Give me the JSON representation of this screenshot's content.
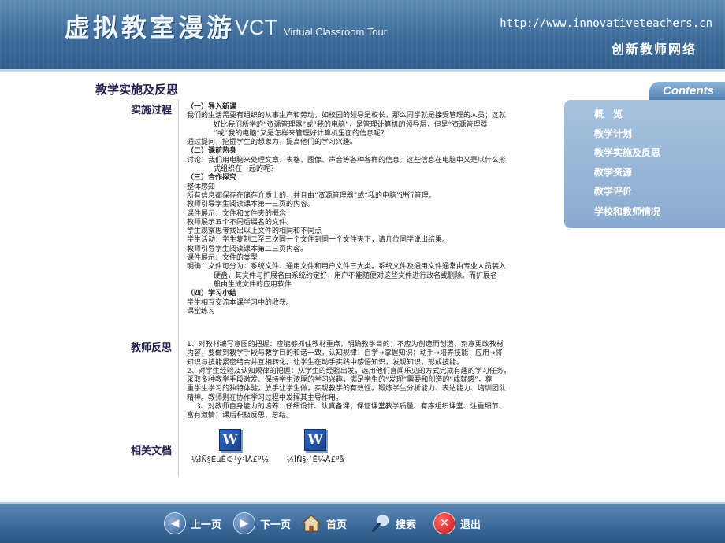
{
  "header": {
    "title_cn": "虚拟教室漫游",
    "title_en": "VCT",
    "subtitle_en": "Virtual Classroom Tour",
    "url": "http://www.innovativeteachers.cn",
    "site_name": "创新教师网络"
  },
  "page": {
    "heading": "教学实施及反思",
    "sections": {
      "implementation_label": "实施过程",
      "reflection_label": "教师反思",
      "docs_label": "相关文档"
    }
  },
  "implementation": [
    {
      "text": "（一）导入新课",
      "style": "h"
    },
    {
      "text": "我们的生活需要有组织的从事生产和劳动，如校园的领导是校长，那么同学就是接受管理的人员；这就",
      "style": ""
    },
    {
      "text": "好比我们所学的“资源管理器”或“我的电脑”，是管理计算机的领导层，但是“资源管理器",
      "style": "ind"
    },
    {
      "text": "”或“我的电脑”又是怎样来管理好计算机里面的信息呢？",
      "style": "ind"
    },
    {
      "text": "通过提问，挖掘学生的想象力，提高他们的学习兴趣。",
      "style": ""
    },
    {
      "text": "（二）课前热身",
      "style": "h"
    },
    {
      "text": "讨论：我们用电脑来处理文章、表格、图像、声音等各种各样的信息。这些信息在电脑中又是以什么形",
      "style": ""
    },
    {
      "text": "式组织在一起的呢？",
      "style": "ind"
    },
    {
      "text": "（三）合作探究",
      "style": "h"
    },
    {
      "text": "整体感知",
      "style": ""
    },
    {
      "text": "所有信息都保存在储存介质上的，并且由“资源管理器”或“我的电脑”进行管理。",
      "style": ""
    },
    {
      "text": "教师引导学生阅读课本第一三页的内容。",
      "style": ""
    },
    {
      "text": "课件展示：文件和文件夹的概念",
      "style": ""
    },
    {
      "text": "教师展示五个不同后缀名的文件。",
      "style": ""
    },
    {
      "text": "学生观察思考找出以上文件的相同和不同点",
      "style": ""
    },
    {
      "text": "学生活动：学生复制二至三次同一个文件到同一个文件夹下，请几位同学说出结果。",
      "style": ""
    },
    {
      "text": "教师引导学生阅读课本第二三页内容。",
      "style": ""
    },
    {
      "text": "课件展示：文件的类型",
      "style": ""
    },
    {
      "text": "明确：文件可分为：系统文件、通用文件和用户文件三大类。系统文件及通用文件通常由专业人员装入",
      "style": ""
    },
    {
      "text": "硬盘，其文件与扩展名由系统约定好，用户不能随便对这些文件进行改名或删除。而扩展名一",
      "style": "ind"
    },
    {
      "text": "般由生成文件的应用软件",
      "style": "ind"
    },
    {
      "text": "（四）学习小结",
      "style": "h"
    },
    {
      "text": "学生相互交流本课学习中的收获。",
      "style": ""
    },
    {
      "text": "课堂练习",
      "style": ""
    }
  ],
  "reflection": [
    {
      "text": "1、对教材编写意图的把握：应能够抓住教材重点，明确教学目的，不应为创造而创造、刻意更改教材",
      "style": ""
    },
    {
      "text": "内容，要做到教学手段与教学目的和谐一致。认知规律：自学→掌握知识；动手→培养技能；应用→将",
      "style": ""
    },
    {
      "text": "知识与技能紧密结合并互相转化。让学生在动手实践中感悟知识，发现知识，形成技能。",
      "style": ""
    },
    {
      "text": "2、对学生经验及认知规律的把握：从学生的经验出发，选用他们喜闻乐见的方式完成有趣的学习任务，",
      "style": ""
    },
    {
      "text": "采取多种教学手段激发、保持学生浓厚的学习兴趣，满足学生的“发现”需要和创造的“成就感”，尊",
      "style": ""
    },
    {
      "text": "重学生学习的独特体验，放手让学生做，实现教学的有效性。锻炼学生分析能力、表达能力、培训团队",
      "style": ""
    },
    {
      "text": "精神。教师则在协作学习过程中发挥其主导作用。",
      "style": ""
    },
    {
      "text": "3、对教师自身能力的培养：仔细设计、认真备课；保证课堂教学质量、有序组织课堂、注重细节、",
      "style": "ind2"
    },
    {
      "text": "富有激情；课后积极反思、总结。",
      "style": ""
    }
  ],
  "documents": [
    {
      "icon": "W",
      "label": "½ÌÑ§ÉµÊ©¹ý³ÌÀ£º½"
    },
    {
      "icon": "W",
      "label": "½ÌÑ§·´Ë¼À£ºå"
    }
  ],
  "contents": {
    "title": "Contents",
    "items": [
      "概　览",
      "教学计划",
      "教学实施及反思",
      "教学资源",
      "教学评价",
      "学校和教师情况"
    ]
  },
  "footer": {
    "prev": "上一页",
    "next": "下一页",
    "home": "首页",
    "search": "搜索",
    "exit": "退出"
  },
  "colors": {
    "header_bg": "#3b6a99",
    "heading_text": "#23224f",
    "panel_bg": "#9bb8d9",
    "exit_button": "#c01414"
  }
}
